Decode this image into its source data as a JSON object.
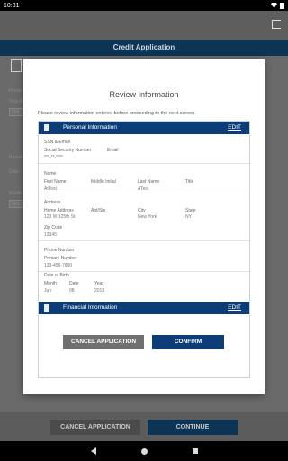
{
  "status_bar": {
    "time": "10:31"
  },
  "app": {
    "title": "Credit Application",
    "bg_texts": [
      "Financ",
      "Total An",
      "$58",
      "Reside",
      "Own",
      "Month",
      "$82"
    ],
    "cancel_label": "CANCEL APPLICATION",
    "continue_label": "CONTINUE"
  },
  "modal": {
    "title": "Review Information",
    "description": "Please review information entered before proceeding to the next screen.",
    "personal": {
      "header": "Personal Information",
      "edit": "EDIT",
      "ssn_email": {
        "section_label": "SSN & Email",
        "ssn_label": "Social Security Number",
        "email_label": "Email",
        "ssn_value": "***-**-****"
      },
      "name": {
        "section_label": "Name",
        "first_name_label": "First Name",
        "middle_initial_label": "Middle Initial",
        "last_name_label": "Last Name",
        "title_label": "Title",
        "first_name_value": "AtTest",
        "last_name_value": "ATest"
      },
      "address": {
        "section_label": "Address",
        "home_address_label": "Home Address",
        "apt_label": "Apt/Ste",
        "city_label": "City",
        "state_label": "State",
        "home_address_value": "123 W 125th St",
        "city_value": "New York",
        "state_value": "NY",
        "zip_label": "Zip Code",
        "zip_value": "12345"
      },
      "phone": {
        "section_label": "Phone Number",
        "primary_label": "Primary Number",
        "primary_value": "123-456-7890"
      },
      "dob": {
        "section_label": "Date of Birth",
        "month_label": "Month",
        "date_label": "Date",
        "year_label": "Year",
        "month_value": "Jun",
        "date_value": "08",
        "year_value": "2019"
      }
    },
    "financial": {
      "header": "Financial Information",
      "edit": "EDIT"
    },
    "cancel_label": "CANCEL APPLICATION",
    "confirm_label": "CONFIRM"
  }
}
